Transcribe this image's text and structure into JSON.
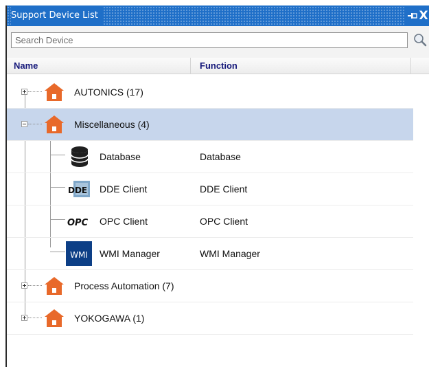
{
  "panel": {
    "title": "Support Device List",
    "pin_icon": "pin-icon",
    "close_icon": "close-icon",
    "close_glyph": "X",
    "accent_color": "#1f6fc8"
  },
  "search": {
    "placeholder": "Search Device",
    "value": "",
    "icon": "search-icon"
  },
  "columns": {
    "name": "Name",
    "function": "Function"
  },
  "tree": {
    "groups": [
      {
        "label": "AUTONICS (17)",
        "expanded": false,
        "icon": "house-icon"
      },
      {
        "label": "Miscellaneous (4)",
        "expanded": true,
        "selected": true,
        "icon": "house-icon",
        "children": [
          {
            "label": "Database",
            "function": "Database",
            "icon": "database-icon"
          },
          {
            "label": "DDE Client",
            "function": "DDE Client",
            "icon": "dde-icon",
            "icon_text": "DDE"
          },
          {
            "label": "OPC Client",
            "function": "OPC Client",
            "icon": "opc-icon",
            "icon_text": "OPC"
          },
          {
            "label": "WMI Manager",
            "function": "WMI Manager",
            "icon": "wmi-icon",
            "icon_text": "WMI"
          }
        ]
      },
      {
        "label": "Process Automation (7)",
        "expanded": false,
        "icon": "house-icon"
      },
      {
        "label": "YOKOGAWA (1)",
        "expanded": false,
        "icon": "house-icon"
      }
    ],
    "house_color": "#e8692a",
    "selected_row_color": "#c7d6ec"
  }
}
